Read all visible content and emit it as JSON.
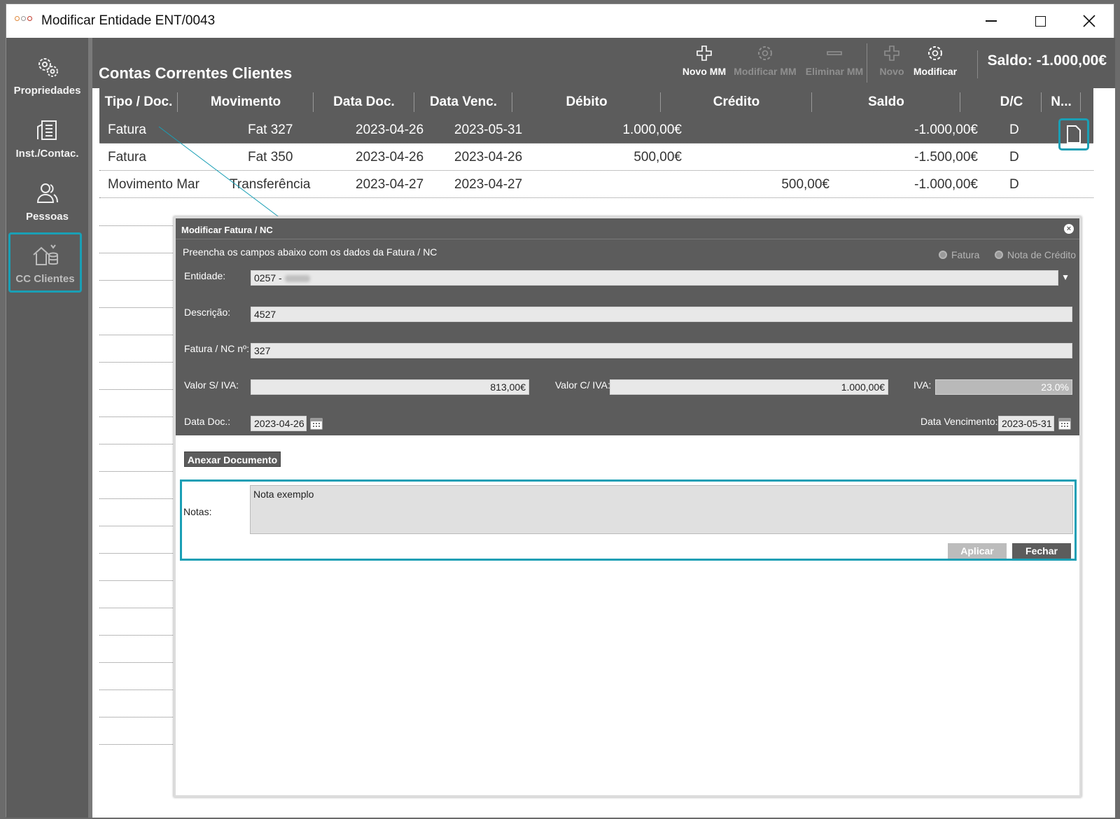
{
  "window": {
    "title": "Modificar Entidade ENT/0043"
  },
  "sidebar": {
    "items": [
      {
        "label": "Propriedades",
        "icon": "gears-icon"
      },
      {
        "label": "Inst./Contac.",
        "icon": "building-icon"
      },
      {
        "label": "Pessoas",
        "icon": "people-icon"
      },
      {
        "label": "CC Clientes",
        "icon": "coins-icon"
      }
    ]
  },
  "header": {
    "title": "Contas Correntes Clientes",
    "toolbar": {
      "novo_mm": "Novo MM",
      "modificar_mm": "Modificar MM",
      "eliminar_mm": "Eliminar MM",
      "novo": "Novo",
      "modificar": "Modificar"
    },
    "saldo": "Saldo: -1.000,00€"
  },
  "table": {
    "columns": [
      "Tipo / Doc.",
      "Movimento",
      "Data Doc.",
      "Data Venc.",
      "Débito",
      "Crédito",
      "Saldo",
      "D/C",
      "N..."
    ],
    "rows": [
      {
        "tipo": "Fatura",
        "movimento": "Fat 327",
        "data_doc": "2023-04-26",
        "data_venc": "2023-05-31",
        "debito": "1.000,00€",
        "credito": "",
        "saldo": "-1.000,00€",
        "dc": "D"
      },
      {
        "tipo": "Fatura",
        "movimento": "Fat 350",
        "data_doc": "2023-04-26",
        "data_venc": "2023-04-26",
        "debito": "500,00€",
        "credito": "",
        "saldo": "-1.500,00€",
        "dc": "D"
      },
      {
        "tipo": "Movimento Mar",
        "movimento": "Transferência",
        "data_doc": "2023-04-27",
        "data_venc": "2023-04-27",
        "debito": "",
        "credito": "500,00€",
        "saldo": "-1.000,00€",
        "dc": "D"
      }
    ]
  },
  "dialog": {
    "title": "Modificar Fatura / NC",
    "instructions": "Preencha os campos abaixo com os dados da Fatura / NC",
    "radio_fatura": "Fatura",
    "radio_nc": "Nota de Crédito",
    "labels": {
      "entidade": "Entidade:",
      "descricao": "Descrição:",
      "fatura_nc": "Fatura / NC nº:",
      "valor_si": "Valor S/ IVA:",
      "valor_ci": "Valor C/ IVA:",
      "iva": "IVA:",
      "data_doc": "Data Doc.:",
      "data_venc": "Data Vencimento:",
      "notas": "Notas:"
    },
    "values": {
      "entidade": "0257 -",
      "descricao": "4527",
      "fatura_nc": "327",
      "valor_si": "813,00€",
      "valor_ci": "1.000,00€",
      "iva": "23.0%",
      "data_doc": "2023-04-26",
      "data_venc": "2023-05-31",
      "notas": "Nota exemplo"
    },
    "buttons": {
      "anexar": "Anexar Documento",
      "aplicar": "Aplicar",
      "fechar": "Fechar"
    }
  },
  "colors": {
    "accent": "#1a9fb5",
    "panel": "#5c5c5c"
  }
}
